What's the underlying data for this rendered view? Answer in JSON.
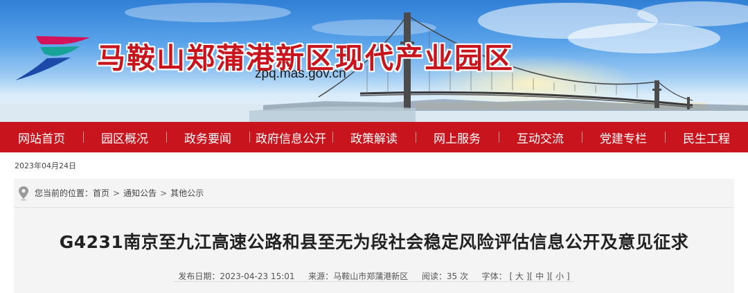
{
  "header": {
    "site_title": "马鞍山郑蒲港新区现代产业园区",
    "domain": "zpq.mas.gov.cn"
  },
  "nav": {
    "items": [
      {
        "label": "网站首页"
      },
      {
        "label": "园区概况"
      },
      {
        "label": "政务要闻"
      },
      {
        "label": "政府信息公开"
      },
      {
        "label": "政策解读"
      },
      {
        "label": "网上服务"
      },
      {
        "label": "互动交流"
      },
      {
        "label": "党建专栏"
      },
      {
        "label": "民生工程"
      }
    ]
  },
  "date": "2023年04月24日",
  "breadcrumb": {
    "prefix": "您当前的位置：",
    "items": [
      "首页",
      "通知公告",
      "其他公示"
    ],
    "separator": ">"
  },
  "article": {
    "title": "G4231南京至九江高速公路和县至无为段社会稳定风险评估信息公开及意见征求",
    "publish_label": "发布日期：",
    "publish_date": "2023-04-23 15:01",
    "source_label": "来源：",
    "source": "马鞍山市郑蒲港新区",
    "views_label": "阅读：",
    "views": "35",
    "views_unit": "次",
    "font_label": "字体：",
    "font_sizes": [
      "大",
      "中",
      "小"
    ]
  },
  "colors": {
    "brand_red": "#c8141c",
    "sky_blue": "#4a95e3"
  }
}
